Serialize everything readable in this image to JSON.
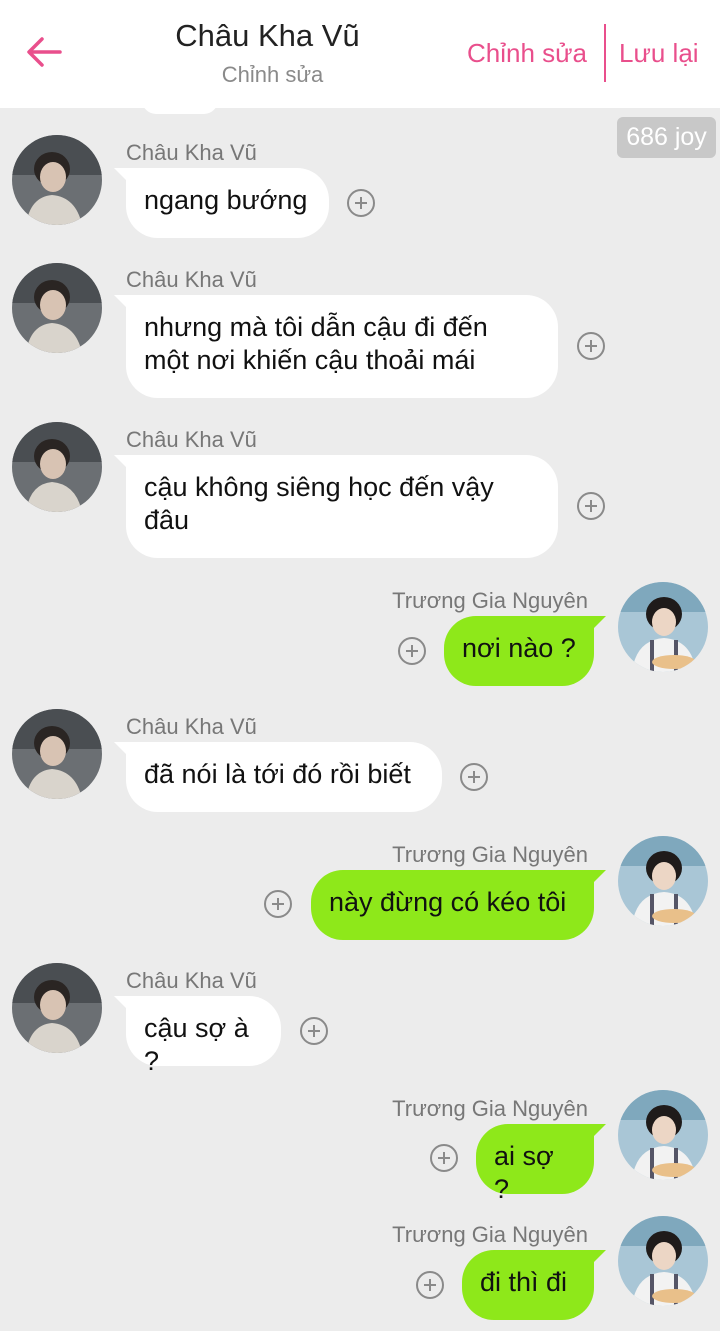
{
  "header": {
    "title": "Châu Kha Vũ",
    "subtitle": "Chỉnh sửa",
    "edit_label": "Chỉnh sửa",
    "save_label": "Lưu lại"
  },
  "joy_badge": "686 joy",
  "messages": [
    {
      "sender": "Châu Kha Vũ",
      "side": "left",
      "text_lines": [
        "ngang bướng"
      ]
    },
    {
      "sender": "Châu Kha Vũ",
      "side": "left",
      "text_lines": [
        "nhưng mà tôi dẫn cậu đi đến",
        "một nơi khiến cậu thoải mái"
      ]
    },
    {
      "sender": "Châu Kha Vũ",
      "side": "left",
      "text_lines": [
        "cậu không siêng học đến vậy",
        "đâu"
      ]
    },
    {
      "sender": "Trương Gia Nguyên",
      "side": "right",
      "text_lines": [
        "nơi nào ?"
      ]
    },
    {
      "sender": "Châu Kha Vũ",
      "side": "left",
      "text_lines": [
        "đã nói là tới đó rồi biết"
      ]
    },
    {
      "sender": "Trương Gia Nguyên",
      "side": "right",
      "text_lines": [
        "này đừng có kéo tôi"
      ]
    },
    {
      "sender": "Châu Kha Vũ",
      "side": "left",
      "text_lines": [
        "cậu sợ à ?"
      ]
    },
    {
      "sender": "Trương Gia Nguyên",
      "side": "right",
      "text_lines": [
        "ai sợ ?"
      ]
    },
    {
      "sender": "Trương Gia Nguyên",
      "side": "right",
      "text_lines": [
        "đi thì đi"
      ]
    }
  ],
  "colors": {
    "accent": "#e94f8c",
    "right_bubble": "#8ee81a",
    "left_bubble": "#ffffff",
    "background": "#ececec"
  }
}
